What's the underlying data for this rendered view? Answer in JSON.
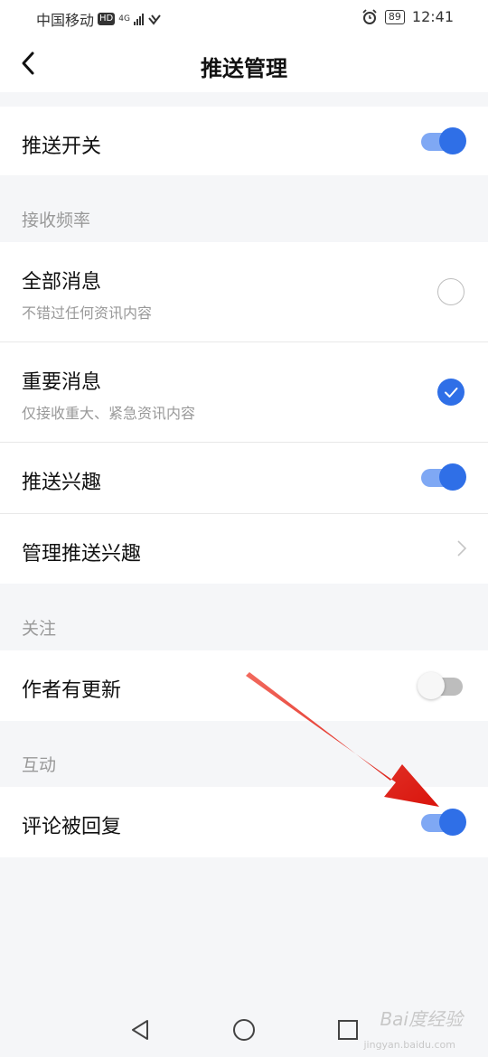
{
  "status_bar": {
    "carrier": "中国移动",
    "hd": "HD",
    "network": "4G",
    "battery": "89",
    "time": "12:41"
  },
  "header": {
    "title": "推送管理",
    "back_icon": "chevron-left-icon"
  },
  "push_switch": {
    "label": "推送开关",
    "on": true
  },
  "frequency": {
    "section_label": "接收频率",
    "options": [
      {
        "title": "全部消息",
        "subtitle": "不错过任何资讯内容",
        "selected": false
      },
      {
        "title": "重要消息",
        "subtitle": "仅接收重大、紧急资讯内容",
        "selected": true
      }
    ]
  },
  "interest": {
    "toggle_label": "推送兴趣",
    "on": true,
    "manage_label": "管理推送兴趣"
  },
  "follow": {
    "section_label": "关注",
    "item_label": "作者有更新",
    "on": false
  },
  "interaction": {
    "section_label": "互动",
    "item_label": "评论被回复",
    "on": true
  },
  "watermark": {
    "text": "Bai度经验",
    "sub": "jingyan.baidu.com"
  },
  "colors": {
    "accent": "#2f6fe7",
    "track_on": "#7fa8f4",
    "arrow": "#e8231a"
  }
}
